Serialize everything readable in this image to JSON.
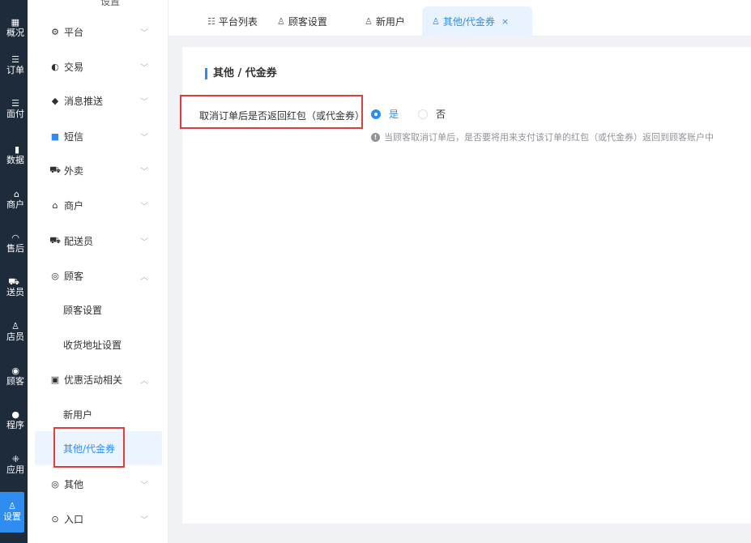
{
  "rail": {
    "items": [
      {
        "icon": "▦",
        "label": "概况",
        "icon_name": "overview-icon"
      },
      {
        "icon": "☰",
        "label": "订单",
        "icon_name": "order-list-icon"
      },
      {
        "icon": "☰",
        "label": "面付",
        "icon_name": "face-pay-icon"
      },
      {
        "icon": "▮",
        "label": "数据",
        "icon_name": "data-chart-icon"
      },
      {
        "icon": "⌂",
        "label": "商户",
        "icon_name": "store-icon"
      },
      {
        "icon": "◠",
        "label": "售后",
        "icon_name": "headset-icon"
      },
      {
        "icon": "⛟",
        "label": "送员",
        "icon_name": "delivery-icon"
      },
      {
        "icon": "♙",
        "label": "店员",
        "icon_name": "staff-icon"
      },
      {
        "icon": "◉",
        "label": "顾客",
        "icon_name": "customer-icon"
      },
      {
        "icon": "●",
        "label": "程序",
        "icon_name": "wechat-icon"
      },
      {
        "icon": "⁜",
        "label": "应用",
        "icon_name": "apps-icon"
      },
      {
        "icon": "♙",
        "label": "设置",
        "icon_name": "settings-icon"
      }
    ]
  },
  "submenu": {
    "top_label": "设置",
    "groups": [
      {
        "icon": "⚙",
        "label": "平台",
        "chevron": "﹀"
      },
      {
        "icon": "◐",
        "label": "交易",
        "chevron": "﹀"
      },
      {
        "icon": "◆",
        "label": "消息推送",
        "chevron": "﹀"
      },
      {
        "icon": "■",
        "label": "短信",
        "chevron": "﹀"
      },
      {
        "icon": "⛟",
        "label": "外卖",
        "chevron": "﹀"
      },
      {
        "icon": "⌂",
        "label": "商户",
        "chevron": "﹀"
      },
      {
        "icon": "⛟",
        "label": "配送员",
        "chevron": "﹀"
      },
      {
        "icon": "◎",
        "label": "顾客",
        "chevron": "︿"
      },
      {
        "icon": "▣",
        "label": "优惠活动相关",
        "chevron": "︿"
      },
      {
        "icon": "◎",
        "label": "其他",
        "chevron": "﹀"
      },
      {
        "icon": "⊙",
        "label": "入口",
        "chevron": "﹀"
      }
    ],
    "customer_subs": [
      "顾客设置",
      "收货地址设置"
    ],
    "promo_subs": [
      "新用户",
      "其他/代金券"
    ]
  },
  "tabs": [
    {
      "icon": "☷",
      "label": "平台列表"
    },
    {
      "icon": "♙",
      "label": "顾客设置"
    },
    {
      "icon": "♙",
      "label": "新用户"
    },
    {
      "icon": "♙",
      "label": "其他/代金券",
      "close": "×"
    }
  ],
  "content": {
    "title": "其他 / 代金券",
    "field_label": "取消订单后是否返回红包（或代金券）",
    "options": [
      {
        "label": "是",
        "checked": true
      },
      {
        "label": "否",
        "checked": false
      }
    ],
    "hint_icon": "!",
    "hint": "当顾客取消订单后，是否要将用来支付该订单的红包（或代金券）返回到顾客账户中"
  },
  "colors": {
    "accent": "#2f8cf0",
    "rail_bg": "#1d2b3a",
    "highlight": "#e23b3b"
  }
}
